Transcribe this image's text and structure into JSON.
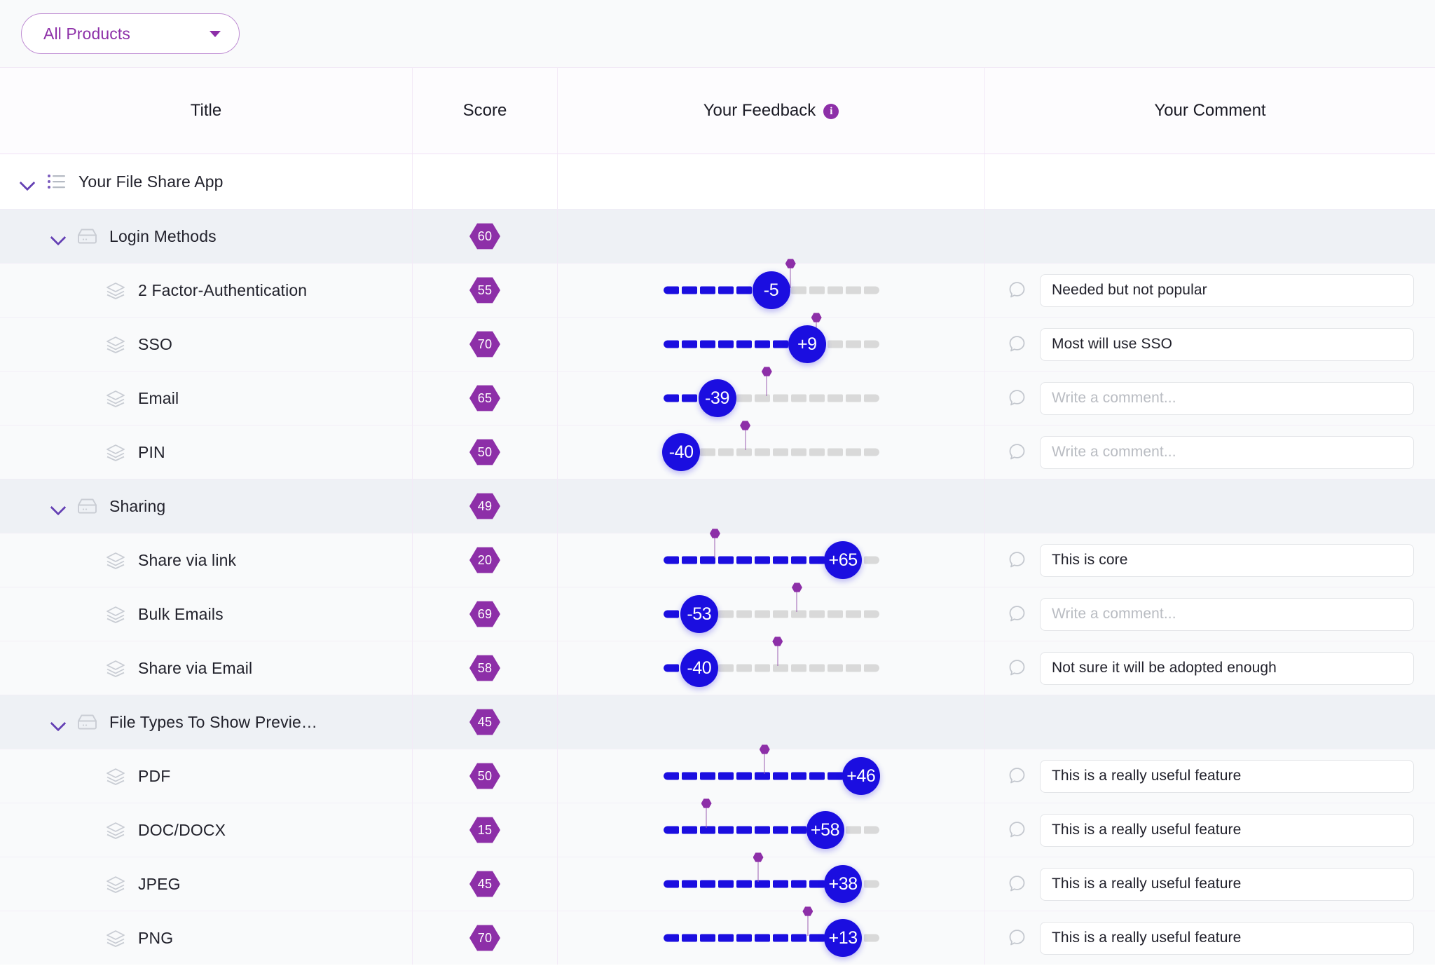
{
  "toolbar": {
    "product_filter_label": "All Products",
    "product_filter_icon": "chevron-down-icon"
  },
  "table": {
    "columns": [
      {
        "key": "title",
        "label": "Title"
      },
      {
        "key": "score",
        "label": "Score"
      },
      {
        "key": "feedback",
        "label": "Your Feedback",
        "info_icon": "info-icon",
        "info_icon_char": "i"
      },
      {
        "key": "comment",
        "label": "Your Comment"
      }
    ],
    "comment_placeholder": "Write a comment...",
    "slider": {
      "segments": 12,
      "min": -100,
      "max": 100
    },
    "rows": [
      {
        "kind": "root",
        "level": 0,
        "icon": "list-icon",
        "expanded": true,
        "title": "Your File Share App",
        "score": null,
        "feedback": null,
        "comment": null
      },
      {
        "kind": "group",
        "level": 1,
        "icon": "drawer-icon",
        "expanded": true,
        "title": "Login Methods",
        "score": "60",
        "feedback": null,
        "comment": null
      },
      {
        "kind": "item",
        "level": 2,
        "icon": "layers-icon",
        "title": "2 Factor-Authentication",
        "score": "55",
        "feedback": {
          "value": -5,
          "label": "-5",
          "filled": 6,
          "pin_pct": 59
        },
        "comment": "Needed but not popular"
      },
      {
        "kind": "item",
        "level": 2,
        "icon": "layers-icon",
        "title": "SSO",
        "score": "70",
        "feedback": {
          "value": 9,
          "label": "+9",
          "filled": 8,
          "pin_pct": 71
        },
        "comment": "Most will use SSO"
      },
      {
        "kind": "item",
        "level": 2,
        "icon": "layers-icon",
        "title": "Email",
        "score": "65",
        "feedback": {
          "value": -39,
          "label": "-39",
          "filled": 3,
          "pin_pct": 48
        },
        "comment": ""
      },
      {
        "kind": "item",
        "level": 2,
        "icon": "layers-icon",
        "title": "PIN",
        "score": "50",
        "feedback": {
          "value": -40,
          "label": "-40",
          "filled": 1,
          "pin_pct": 38
        },
        "comment": ""
      },
      {
        "kind": "group",
        "level": 1,
        "icon": "drawer-icon",
        "expanded": true,
        "title": "Sharing",
        "score": "49",
        "feedback": null,
        "comment": null
      },
      {
        "kind": "item",
        "level": 2,
        "icon": "layers-icon",
        "title": "Share via link",
        "score": "20",
        "feedback": {
          "value": 65,
          "label": "+65",
          "filled": 10,
          "pin_pct": 24
        },
        "comment": "This is core"
      },
      {
        "kind": "item",
        "level": 2,
        "icon": "layers-icon",
        "title": "Bulk Emails",
        "score": "69",
        "feedback": {
          "value": -53,
          "label": "-53",
          "filled": 2,
          "pin_pct": 62
        },
        "comment": ""
      },
      {
        "kind": "item",
        "level": 2,
        "icon": "layers-icon",
        "title": "Share via Email",
        "score": "58",
        "feedback": {
          "value": -40,
          "label": "-40",
          "filled": 2,
          "pin_pct": 53
        },
        "comment": "Not sure it will be adopted enough"
      },
      {
        "kind": "group",
        "level": 1,
        "icon": "drawer-icon",
        "expanded": true,
        "title": "File Types To Show Previe…",
        "score": "45",
        "feedback": null,
        "comment": null
      },
      {
        "kind": "item",
        "level": 2,
        "icon": "layers-icon",
        "title": "PDF",
        "score": "50",
        "feedback": {
          "value": 46,
          "label": "+46",
          "filled": 11,
          "pin_pct": 47
        },
        "comment": "This is a really useful feature"
      },
      {
        "kind": "item",
        "level": 2,
        "icon": "layers-icon",
        "title": "DOC/DOCX",
        "score": "15",
        "feedback": {
          "value": 58,
          "label": "+58",
          "filled": 9,
          "pin_pct": 20
        },
        "comment": "This is a really useful feature"
      },
      {
        "kind": "item",
        "level": 2,
        "icon": "layers-icon",
        "title": "JPEG",
        "score": "45",
        "feedback": {
          "value": 38,
          "label": "+38",
          "filled": 10,
          "pin_pct": 44
        },
        "comment": "This is a really useful feature"
      },
      {
        "kind": "item",
        "level": 2,
        "icon": "layers-icon",
        "title": "PNG",
        "score": "70",
        "feedback": {
          "value": 13,
          "label": "+13",
          "filled": 10,
          "pin_pct": 67
        },
        "comment": "This is a really useful feature"
      }
    ]
  },
  "colors": {
    "accent_purple": "#8d2fa8",
    "slider_blue": "#1b0ee0",
    "chevron_purple": "#6440b4",
    "group_row_bg": "#eef1f5",
    "item_row_bg": "#f9fafb"
  }
}
